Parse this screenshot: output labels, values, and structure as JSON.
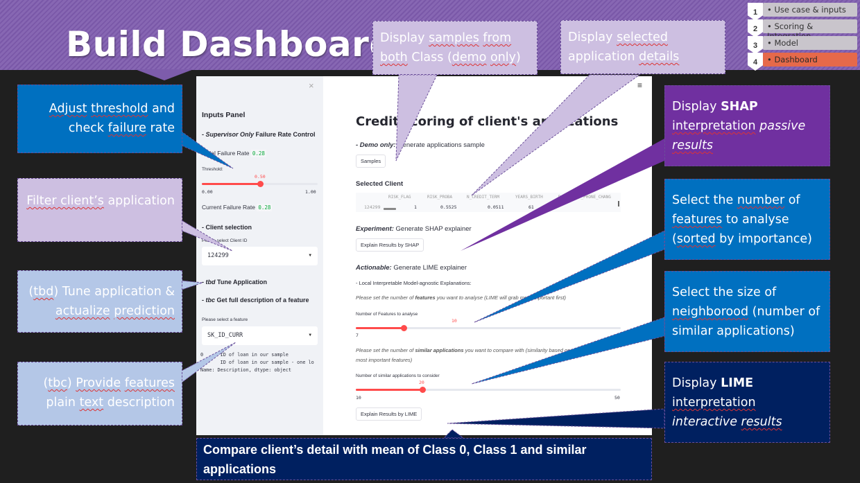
{
  "slide": {
    "title": "Build Dashboard",
    "steps": [
      {
        "num": "1",
        "label": "• Use case & inputs",
        "active": false
      },
      {
        "num": "2",
        "label": "• Scoring & Integration",
        "active": false
      },
      {
        "num": "3",
        "label": "• Model",
        "active": false
      },
      {
        "num": "4",
        "label": "• Dashboard",
        "active": true
      }
    ],
    "colors": {
      "header": "#8767b3",
      "active_step": "#e6694a",
      "accent_red": "#ff4b4b"
    }
  },
  "sidebar": {
    "close_icon": "×",
    "title": "Inputs Panel",
    "failure_section": {
      "prefix": "- ",
      "italic": "Supervisor Only",
      "rest": " Failure Rate Control"
    },
    "initial_failure_label": "Initial Failure Rate",
    "initial_failure_value": "0.28",
    "threshold_label": "Threshold:",
    "threshold": {
      "value": "0.50",
      "min": "0.00",
      "max": "1.00",
      "fraction": 0.5
    },
    "current_failure_label": "Current Failure Rate",
    "current_failure_value": "0.28",
    "client_section": "- Client selection",
    "client_select_label": "Please select Client ID",
    "client_id": "124299",
    "tune_section": {
      "prefix": "- ",
      "italic": "tbd",
      "rest": " Tune Application"
    },
    "desc_section": {
      "prefix": "- ",
      "italic": "tbc",
      "rest": " Get full description of a feature"
    },
    "feature_select_label": "Please select a feature",
    "feature_value": "SK_ID_CURR",
    "description_lines": [
      "0      ID of loan in our sample",
      "       ID of loan in our sample - one lo",
      "Name: Description, dtype: object"
    ]
  },
  "main": {
    "menu_icon": "≡",
    "title": "Credit scoring of client's applications",
    "demo": {
      "italic": "- Demo only:",
      "rest": " Generate applications sample"
    },
    "samples_button": "Samples",
    "selected_client_header": "Selected Client",
    "table": {
      "columns": [
        "RISK_FLAG",
        "RISK_PROBA",
        "N_CREDIT_TERM",
        "YEARS_BIRTH",
        "DAYS_LAST_PHONE_CHANG"
      ],
      "rows": [
        {
          "index": "124299",
          "values": [
            "1",
            "0.5525",
            "0.0511",
            "61",
            ""
          ]
        }
      ]
    },
    "shap": {
      "italic": "Experiment:",
      "rest": " Generate SHAP explainer"
    },
    "shap_button": "Explain Results by SHAP",
    "lime": {
      "italic": "Actionable:",
      "rest": " Generate LIME explainer"
    },
    "lime_subtitle": "- Local Interpretable Model-agnostic Explanations:",
    "features_help": {
      "pre": "Please set the number of ",
      "bold": "features",
      "post": " you want to analyse (LIME will grab most important first)"
    },
    "features_slider_label": "Number of Features to analyse",
    "features_slider": {
      "value": "10",
      "min": "7",
      "fraction": 0.18
    },
    "similar_help": {
      "pre": "Please set the number of ",
      "bold": "similar applications",
      "post": " you want to compare with (similarity based on",
      "line2": "most important features)"
    },
    "similar_slider_label": "Number of similar applications to consider",
    "similar_slider": {
      "value": "20",
      "min": "10",
      "max": "50",
      "fraction": 0.25
    },
    "lime_button": "Explain Results by LIME"
  },
  "callouts": {
    "threshold": {
      "parts": [
        {
          "t": "Adjust",
          "u": true
        },
        {
          "t": " "
        },
        {
          "t": "threshold",
          "u": true
        },
        {
          "t": " and check "
        },
        {
          "t": "failure",
          "u": true
        },
        {
          "t": " rate"
        }
      ]
    },
    "filter": {
      "parts": [
        {
          "t": "Filter client’s",
          "u": true
        },
        {
          "t": " application"
        }
      ]
    },
    "tune": {
      "parts": [
        {
          "t": "("
        },
        {
          "t": "tbd",
          "u": true
        },
        {
          "t": ") Tune application & "
        },
        {
          "t": "actualize",
          "u": true
        },
        {
          "t": " "
        },
        {
          "t": "prediction",
          "u": true
        }
      ]
    },
    "describe": {
      "parts": [
        {
          "t": "("
        },
        {
          "t": "tbc",
          "u": true
        },
        {
          "t": ") "
        },
        {
          "t": "Provide",
          "u": true
        },
        {
          "t": " "
        },
        {
          "t": "features",
          "u": true
        },
        {
          "t": " plain "
        },
        {
          "t": "text",
          "u": true
        },
        {
          "t": " description"
        }
      ]
    },
    "samples": {
      "parts": [
        {
          "t": "Display "
        },
        {
          "t": "samples",
          "u": true
        },
        {
          "t": " "
        },
        {
          "t": "from",
          "u": true
        },
        {
          "t": " "
        },
        {
          "t": "both",
          "u": true
        },
        {
          "t": " Class ("
        },
        {
          "t": "demo",
          "u": true
        },
        {
          "t": " "
        },
        {
          "t": "only",
          "u": true
        },
        {
          "t": ")"
        }
      ]
    },
    "details": {
      "parts": [
        {
          "t": "Display "
        },
        {
          "t": "selected",
          "u": true
        },
        {
          "t": " application "
        },
        {
          "t": "details",
          "u": true
        }
      ]
    },
    "shap": {
      "parts": [
        {
          "t": "Display "
        },
        {
          "t": "SHAP",
          "b": true
        },
        {
          "t": " "
        },
        {
          "t": "interpretation",
          "u": true
        },
        {
          "t": " "
        },
        {
          "t": "passive",
          "i": true
        },
        {
          "t": " "
        },
        {
          "t": "results",
          "i": true,
          "u": true
        }
      ]
    },
    "features": {
      "parts": [
        {
          "t": "Select the "
        },
        {
          "t": "number",
          "u": true
        },
        {
          "t": " of "
        },
        {
          "t": "features",
          "u": true
        },
        {
          "t": " to analyse ("
        },
        {
          "t": "sorted",
          "u": true
        },
        {
          "t": " by importance)"
        }
      ]
    },
    "neighborhood": {
      "parts": [
        {
          "t": "Select the size of "
        },
        {
          "t": "neighborood",
          "u": true
        },
        {
          "t": " (number of similar applications)"
        }
      ]
    },
    "lime": {
      "parts": [
        {
          "t": "Display "
        },
        {
          "t": "LIME",
          "b": true
        },
        {
          "t": " "
        },
        {
          "t": "interpretation",
          "u": true
        },
        {
          "t": " "
        },
        {
          "t": "interactive",
          "i": true
        },
        {
          "t": " "
        },
        {
          "t": "results",
          "i": true,
          "u": true
        }
      ]
    },
    "compare": {
      "text": "Compare client’s detail with mean of Class 0, Class 1 and similar applications"
    }
  }
}
